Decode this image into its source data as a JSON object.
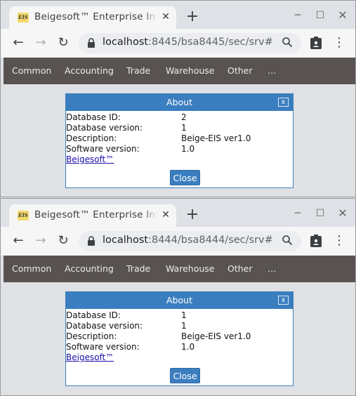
{
  "windows": [
    {
      "tab": {
        "title": "Beigesoft™ Enterprise Information System",
        "favicon": "EIS",
        "close": "✕"
      },
      "newtab": "+",
      "window_controls": {
        "minimize": "─",
        "maximize": "☐",
        "close": "✕"
      },
      "url": {
        "host": "localhost",
        "rest": ":8445/bsa8445/sec/srv#"
      },
      "menu": [
        "Common",
        "Accounting",
        "Trade",
        "Warehouse",
        "Other",
        "…"
      ],
      "dialog": {
        "title": "About",
        "close_x": "x",
        "rows": [
          {
            "label": "Database ID:",
            "value": "2"
          },
          {
            "label": "Database version:",
            "value": "1"
          },
          {
            "label": "Description:",
            "value": "Beige-EIS ver1.0"
          },
          {
            "label": "Software version:",
            "value": "1.0"
          }
        ],
        "link": "Beigesoft™",
        "close_button": "Close"
      }
    },
    {
      "tab": {
        "title": "Beigesoft™ Enterprise Information System",
        "favicon": "EIS",
        "close": "✕"
      },
      "newtab": "+",
      "window_controls": {
        "minimize": "─",
        "maximize": "☐",
        "close": "✕"
      },
      "url": {
        "host": "localhost",
        "rest": ":8444/bsa8444/sec/srv#"
      },
      "menu": [
        "Common",
        "Accounting",
        "Trade",
        "Warehouse",
        "Other",
        "…"
      ],
      "dialog": {
        "title": "About",
        "close_x": "x",
        "rows": [
          {
            "label": "Database ID:",
            "value": "1"
          },
          {
            "label": "Database version:",
            "value": "1"
          },
          {
            "label": "Description:",
            "value": "Beige-EIS ver1.0"
          },
          {
            "label": "Software version:",
            "value": "1.0"
          }
        ],
        "link": "Beigesoft™",
        "close_button": "Close"
      }
    }
  ],
  "icons": {
    "back": "←",
    "forward": "→",
    "reload": "↻",
    "zoom": "🔍",
    "menu": "⋮"
  },
  "colors": {
    "nav_bar": "#585351",
    "dialog_header": "#3b7ec0",
    "link": "#1a0dab"
  }
}
